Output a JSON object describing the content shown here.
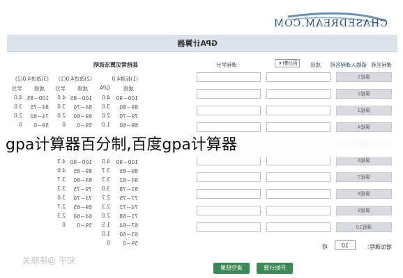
{
  "logo": {
    "text": "CHASEDREAM.COM"
  },
  "window": {
    "title": "GPA计算器"
  },
  "conversion": {
    "header": "其他常见算法说明",
    "col_headers": [
      "(1)标准4.0",
      "(2)改进4.0(1)",
      "(3)改进4.0(2)"
    ],
    "sub_headers": [
      "成绩",
      "GPA",
      "成绩",
      "学分",
      "成绩",
      "学分"
    ],
    "rows": [
      [
        "100－90",
        "4.0",
        "100－85",
        "4.0",
        "100－85",
        "4.0"
      ],
      [
        "89－80",
        "3.0",
        "84－70",
        "3.0",
        "84－75",
        "3.0"
      ],
      [
        "79－70",
        "2.0",
        "69－60",
        "2.0",
        "74－60",
        "2.0"
      ],
      [
        "69－60",
        "1.0",
        "59－0",
        "0",
        "59－0",
        "0"
      ]
    ],
    "rows2": [
      [
        "100－90",
        "4.0",
        "100－90",
        "4.3"
      ],
      [
        "89－85",
        "3.7",
        "89－85",
        "4.0"
      ],
      [
        "84－82",
        "3.3",
        "84－80",
        "3.7"
      ],
      [
        "81－78",
        "3.0",
        "79－75",
        "3.3"
      ],
      [
        "77－75",
        "2.7",
        "74－70",
        "3.0"
      ],
      [
        "74－72",
        "2.3",
        "69－65",
        "2.7"
      ],
      [
        "71－68",
        "2.0",
        "64－60",
        "2.3"
      ],
      [
        "67－64",
        "1.5",
        "59－0",
        "0"
      ],
      [
        "63－60",
        "1.0"
      ],
      [
        "59－0",
        "0"
      ]
    ]
  },
  "form": {
    "col_course": "课程名称",
    "col_course_hint": "请输入课程名称",
    "col_score": "成绩",
    "score_mode": "百分制",
    "col_credit": "课程学分",
    "rows": [
      "课程1",
      "课程2",
      "课程3",
      "课程4",
      "课程5",
      "课程6",
      "课程7",
      "课程8",
      "课程9",
      "课程10"
    ],
    "count_label": "增加课程：",
    "count_value": "10",
    "count_unit": "项",
    "btn_calc": "开始计算",
    "btn_reset": "清空结果"
  },
  "watermark": "知乎 @陈晓关",
  "headline": "gpa计算器百分制,百度gpa计算器"
}
